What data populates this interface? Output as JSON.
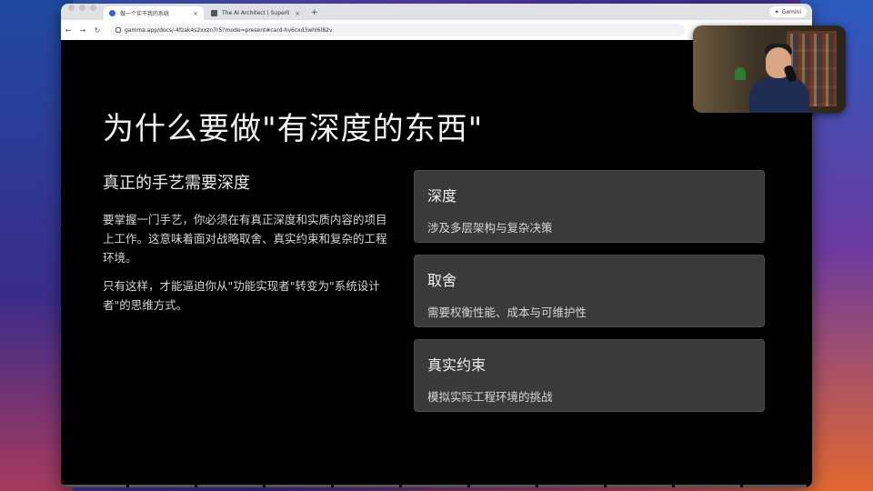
{
  "browser": {
    "tabs": [
      {
        "title": "做一个实干我的系统",
        "active": true
      },
      {
        "title": "The AI Architect | Superlinea",
        "active": false
      }
    ],
    "new_tab_symbol": "+",
    "close_symbol": "×",
    "gemini_label": "Gemini",
    "url": "gamma.app/docs/-4fzak4s2xxzn7r5?mode=present#card-hv6cxd3whl6l82v",
    "nav": {
      "back": "←",
      "forward": "→",
      "reload": "↻"
    }
  },
  "slide": {
    "title": "为什么要做\"有深度的东西\"",
    "subheading": "真正的手艺需要深度",
    "paragraphs": [
      "要掌握一门手艺，你必须在有真正深度和实质内容的项目上工作。这意味着面对战略取舍、真实约束和复杂的工程环境。",
      "只有这样，才能逼迫你从\"功能实现者\"转变为\"系统设计者\"的思维方式。"
    ],
    "cards": [
      {
        "title": "深度",
        "desc": "涉及多层架构与复杂决策"
      },
      {
        "title": "取舍",
        "desc": "需要权衡性能、成本与可维护性"
      },
      {
        "title": "真实约束",
        "desc": "模拟实际工程环境的挑战"
      }
    ]
  },
  "colors": {
    "slide_bg": "#000000",
    "card_bg": "#3a3a3c",
    "text_primary": "#f2f2f2"
  }
}
